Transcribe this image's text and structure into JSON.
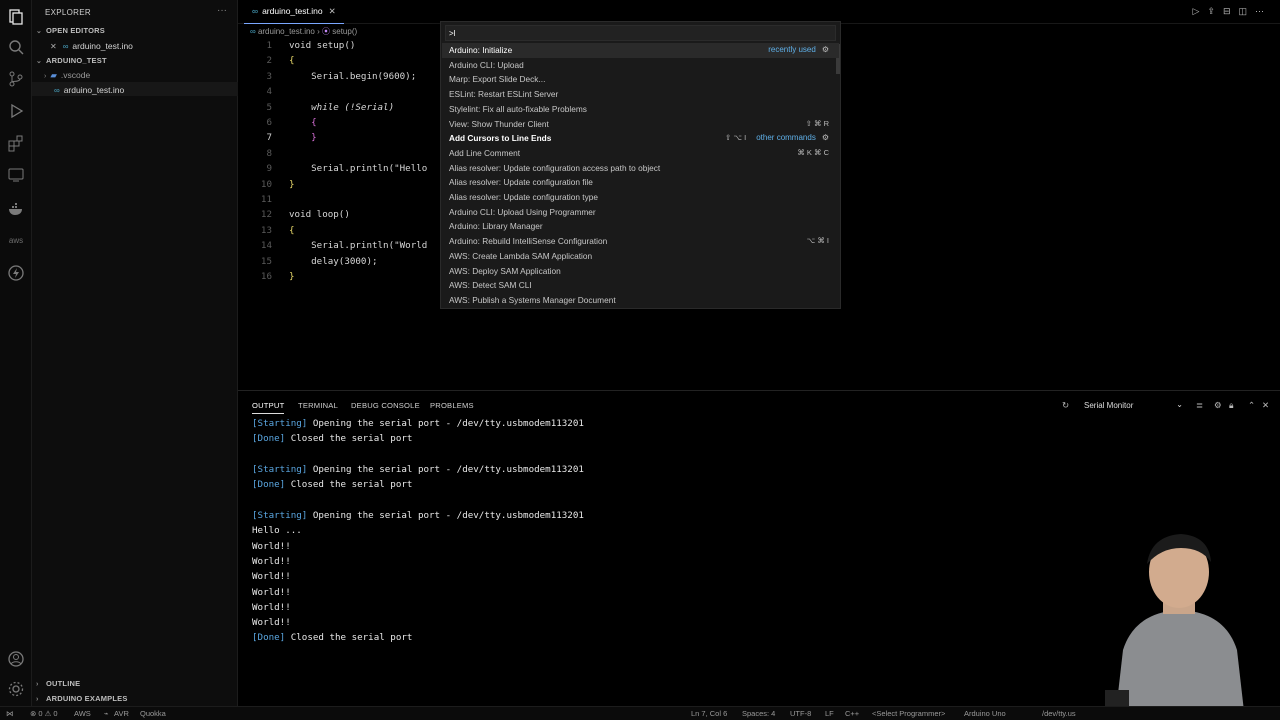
{
  "tabs": {
    "active": "arduino_test.ino"
  },
  "breadcrumb": {
    "file": "arduino_test.ino",
    "sep": "›",
    "symbol": "setup()"
  },
  "sidebar": {
    "title": "EXPLORER",
    "more": "···",
    "open_editors": "OPEN EDITORS",
    "open_file": "arduino_test.ino",
    "project": "ARDUINO_TEST",
    "folder": ".vscode",
    "file": "arduino_test.ino",
    "outline": "OUTLINE",
    "examples": "ARDUINO EXAMPLES"
  },
  "code": [
    {
      "n": "1",
      "t": "void setup()"
    },
    {
      "n": "2",
      "t": "{"
    },
    {
      "n": "3",
      "t": "    Serial.begin(9600);"
    },
    {
      "n": "4",
      "t": ""
    },
    {
      "n": "5",
      "t": "    while (!Serial)"
    },
    {
      "n": "6",
      "t": "    {"
    },
    {
      "n": "7",
      "t": "    }"
    },
    {
      "n": "8",
      "t": ""
    },
    {
      "n": "9",
      "t": "    Serial.println(\"Hello"
    },
    {
      "n": "10",
      "t": "}"
    },
    {
      "n": "11",
      "t": ""
    },
    {
      "n": "12",
      "t": "void loop()"
    },
    {
      "n": "13",
      "t": "{"
    },
    {
      "n": "14",
      "t": "    Serial.println(\"World"
    },
    {
      "n": "15",
      "t": "    delay(3000);"
    },
    {
      "n": "16",
      "t": "}"
    }
  ],
  "palette": {
    "input": ">l",
    "items": [
      "Arduino: Initialize",
      "Arduino CLI: Upload",
      "Marp: Export Slide Deck...",
      "ESLint: Restart ESLint Server",
      "Stylelint: Fix all auto-fixable Problems",
      "View: Show Thunder Client",
      "Add Cursors to Line Ends",
      "Add Line Comment",
      "Alias resolver: Update configuration access path to object",
      "Alias resolver: Update configuration file",
      "Alias resolver: Update configuration type",
      "Arduino CLI: Upload Using Programmer",
      "Arduino: Library Manager",
      "Arduino: Rebuild IntelliSense Configuration",
      "AWS: Create Lambda SAM Application",
      "AWS: Deploy SAM Application",
      "AWS: Detect SAM CLI",
      "AWS: Publish a Systems Manager Document"
    ],
    "recently_used": "recently used",
    "other_commands": "other commands",
    "kb_thunder": "⇧ ⌘ R",
    "kb_cursors": "⇧ ⌥ I",
    "kb_comment": "⌘ K ⌘ C",
    "kb_rebuild": "⌥ ⌘ I"
  },
  "panel": {
    "tabs": [
      "OUTPUT",
      "TERMINAL",
      "DEBUG CONSOLE",
      "PROBLEMS"
    ],
    "select": "Serial Monitor",
    "lines": [
      {
        "tag": "[Starting]",
        "text": " Opening the serial port - /dev/tty.usbmodem113201"
      },
      {
        "tag": "[Done]",
        "text": " Closed the serial port"
      },
      {
        "tag": "",
        "text": ""
      },
      {
        "tag": "[Starting]",
        "text": " Opening the serial port - /dev/tty.usbmodem113201"
      },
      {
        "tag": "[Done]",
        "text": " Closed the serial port"
      },
      {
        "tag": "",
        "text": ""
      },
      {
        "tag": "[Starting]",
        "text": " Opening the serial port - /dev/tty.usbmodem113201"
      },
      {
        "tag": "",
        "text": "Hello ..."
      },
      {
        "tag": "",
        "text": "World!!"
      },
      {
        "tag": "",
        "text": "World!!"
      },
      {
        "tag": "",
        "text": "World!!"
      },
      {
        "tag": "",
        "text": "World!!"
      },
      {
        "tag": "",
        "text": "World!!"
      },
      {
        "tag": "",
        "text": "World!!"
      },
      {
        "tag": "[Done]",
        "text": " Closed the serial port"
      }
    ]
  },
  "status": {
    "errors": "⊗ 0 ⚠ 0",
    "aws": "AWS",
    "avr": "AVR",
    "quokka": "Quokka",
    "pos": "Ln 7, Col 6",
    "spaces": "Spaces: 4",
    "enc": "UTF-8",
    "eol": "LF",
    "lang": "C++",
    "prog": "<Select Programmer>",
    "board": "Arduino Uno",
    "port": "/dev/tty.us"
  }
}
